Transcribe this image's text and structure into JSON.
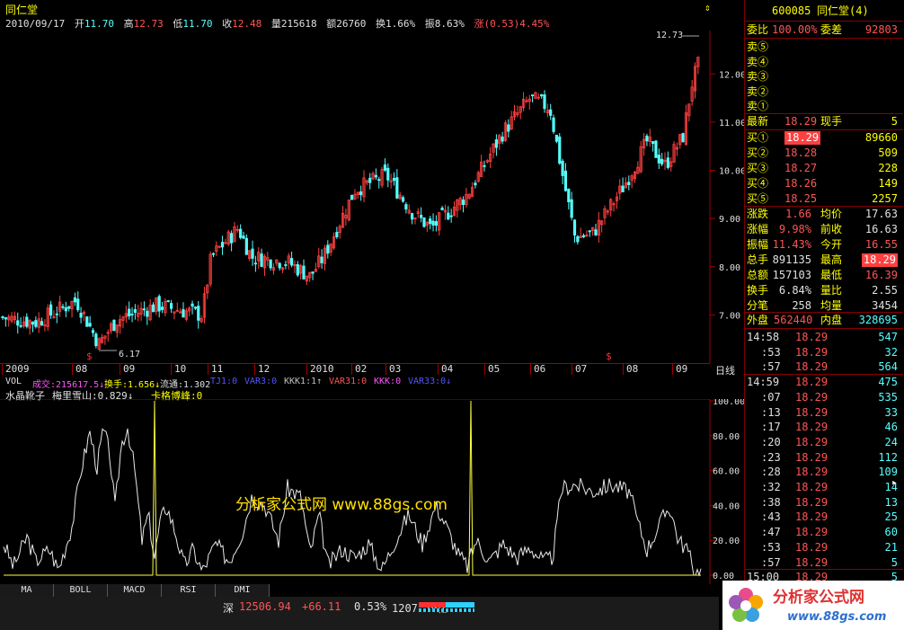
{
  "title": "同仁堂",
  "info": {
    "date": "2010/09/17",
    "open_label": "开",
    "open": "11.70",
    "high_label": "高",
    "high": "12.73",
    "low_label": "低",
    "low": "11.70",
    "close_label": "收",
    "close": "12.48",
    "vol_label": "量",
    "vol": "215618",
    "amt_label": "额",
    "amt": "26760",
    "turn_label": "换",
    "turn": "1.66%",
    "amp_label": "振",
    "amp": "8.63%",
    "chg_label": "涨",
    "chg": "(0.53)",
    "chgpct": "4.45%"
  },
  "price_axis": [
    "12.00",
    "11.00",
    "10.00",
    "9.00",
    "8.00",
    "7.00"
  ],
  "price_annotations": {
    "max": "12.73",
    "min": "6.17"
  },
  "date_axis": [
    "2009",
    "08",
    "09",
    "10",
    "11",
    "12",
    "2010",
    "02",
    "03",
    "04",
    "05",
    "06",
    "07",
    "08",
    "09"
  ],
  "period_label": "日线",
  "vol_bar": {
    "name": "VOL",
    "items": [
      {
        "label": "成交:215617.5↓",
        "color": "#ff55ff"
      },
      {
        "label": "换手:1.656↓",
        "color": "#ffff00"
      },
      {
        "label": "流通:1.302",
        "color": "#e0e0e0"
      },
      {
        "label": "TJ1:0",
        "color": "#5555ff"
      },
      {
        "label": "VAR3:0",
        "color": "#5555ff"
      },
      {
        "label": "KKK1:1↑",
        "color": "#c0c0c0"
      },
      {
        "label": "VAR31:0",
        "color": "#ff5555"
      },
      {
        "label": "KKK:0",
        "color": "#ff55ff"
      },
      {
        "label": "VAR33:0↓",
        "color": "#5555ff"
      }
    ]
  },
  "indicator": {
    "name": "水晶靴子",
    "items": [
      {
        "label": "梅里雪山:0.829↓",
        "color": "#e0e0e0"
      },
      {
        "label": "卡格博峰:0",
        "color": "#ffff00"
      }
    ],
    "axis": [
      "100.00",
      "80.00",
      "60.00",
      "40.00",
      "20.00",
      "0.00"
    ],
    "watermark": "分析家公式网 www.88gs.com"
  },
  "tabs": [
    "MA",
    "BOLL",
    "MACD",
    "RSI",
    "DMI"
  ],
  "status": {
    "market": "深",
    "index": "12506.94",
    "change": "+66.11",
    "pct": "0.53%",
    "amount": "1207.29亿"
  },
  "panel": {
    "code": "600085",
    "name": "同仁堂(4)",
    "weibi_label": "委比",
    "weibi": "100.00%",
    "weicha_label": "委差",
    "weicha": "92803",
    "sells": [
      "卖⑤",
      "卖④",
      "卖③",
      "卖②",
      "卖①"
    ],
    "latest_label": "最新",
    "latest": "18.29",
    "xianshou_label": "现手",
    "xianshou": "5",
    "buys": [
      {
        "label": "买①",
        "price": "18.29",
        "vol": "89660"
      },
      {
        "label": "买②",
        "price": "18.28",
        "vol": "509"
      },
      {
        "label": "买③",
        "price": "18.27",
        "vol": "228"
      },
      {
        "label": "买④",
        "price": "18.26",
        "vol": "149"
      },
      {
        "label": "买⑤",
        "price": "18.25",
        "vol": "2257"
      }
    ],
    "stats": [
      {
        "l1": "涨跌",
        "v1": "1.66",
        "l2": "均价",
        "v2": "17.63"
      },
      {
        "l1": "涨幅",
        "v1": "9.98%",
        "l2": "前收",
        "v2": "16.63"
      },
      {
        "l1": "振幅",
        "v1": "11.43%",
        "l2": "今开",
        "v2": "16.55"
      },
      {
        "l1": "总手",
        "v1": "891135",
        "l2": "最高",
        "v2": "18.29"
      },
      {
        "l1": "总额",
        "v1": "157103",
        "l2": "最低",
        "v2": "16.39"
      },
      {
        "l1": "换手",
        "v1": "6.84%",
        "l2": "量比",
        "v2": "2.55"
      },
      {
        "l1": "分笔",
        "v1": "258",
        "l2": "均量",
        "v2": "3454"
      }
    ],
    "waipan_label": "外盘",
    "waipan": "562440",
    "neipan_label": "内盘",
    "neipan": "328695",
    "ticks": [
      {
        "t": "14:58",
        "p": "18.29",
        "v": "547"
      },
      {
        "t": ":53",
        "p": "18.29",
        "v": "32"
      },
      {
        "t": ":57",
        "p": "18.29",
        "v": "564"
      },
      {
        "t": "14:59",
        "p": "18.29",
        "v": "475"
      },
      {
        "t": ":07",
        "p": "18.29",
        "v": "535"
      },
      {
        "t": ":13",
        "p": "18.29",
        "v": "33"
      },
      {
        "t": ":17",
        "p": "18.29",
        "v": "46"
      },
      {
        "t": ":20",
        "p": "18.29",
        "v": "24"
      },
      {
        "t": ":23",
        "p": "18.29",
        "v": "112"
      },
      {
        "t": ":28",
        "p": "18.29",
        "v": "109"
      },
      {
        "t": ":32",
        "p": "18.29",
        "v": "14"
      },
      {
        "t": ":38",
        "p": "18.29",
        "v": "13"
      },
      {
        "t": ":43",
        "p": "18.29",
        "v": "25"
      },
      {
        "t": ":47",
        "p": "18.29",
        "v": "60"
      },
      {
        "t": ":53",
        "p": "18.29",
        "v": "21"
      },
      {
        "t": ":57",
        "p": "18.29",
        "v": "5"
      },
      {
        "t": "15:00",
        "p": "18.29",
        "v": "5"
      }
    ]
  },
  "logo": {
    "text": "分析家公式网",
    "url": "www.88gs.com"
  }
}
